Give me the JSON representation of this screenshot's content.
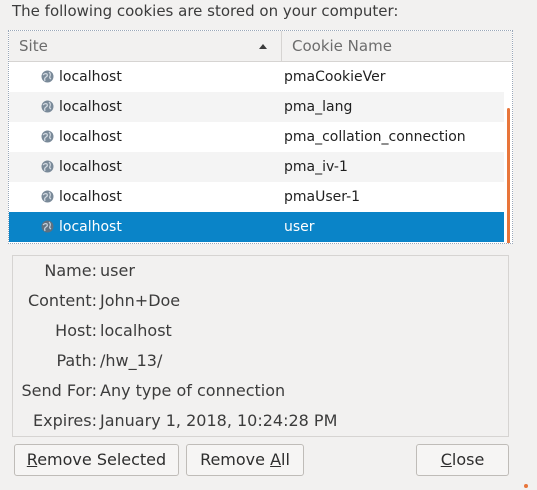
{
  "heading": "The following cookies are stored on your computer:",
  "table": {
    "columns": {
      "site": "Site",
      "cookie_name": "Cookie Name"
    },
    "sort": "ascending",
    "rows": [
      {
        "site": "localhost",
        "cookie_name": "pmaCookieVer",
        "selected": false
      },
      {
        "site": "localhost",
        "cookie_name": "pma_lang",
        "selected": false
      },
      {
        "site": "localhost",
        "cookie_name": "pma_collation_connection",
        "selected": false
      },
      {
        "site": "localhost",
        "cookie_name": "pma_iv-1",
        "selected": false
      },
      {
        "site": "localhost",
        "cookie_name": "pmaUser-1",
        "selected": false
      },
      {
        "site": "localhost",
        "cookie_name": "user",
        "selected": true
      }
    ],
    "row_icon": "globe-icon"
  },
  "details": {
    "name_label": "Name:",
    "name_value": "user",
    "content_label": "Content:",
    "content_value": "John+Doe",
    "host_label": "Host:",
    "host_value": "localhost",
    "path_label": "Path:",
    "path_value": "/hw_13/",
    "send_for_label": "Send For:",
    "send_for_value": "Any type of connection",
    "expires_label": "Expires:",
    "expires_value": "January 1, 2018, 10:24:28 PM"
  },
  "buttons": {
    "remove_selected": {
      "label": "Remove Selected",
      "accesskey": "R"
    },
    "remove_all": {
      "label": "Remove All",
      "accesskey": "A"
    },
    "close": {
      "label": "Close",
      "accesskey": "C"
    }
  },
  "colors": {
    "selection": "#0a84c8",
    "scrollbar": "#e8753a",
    "background": "#f2f1f0"
  }
}
